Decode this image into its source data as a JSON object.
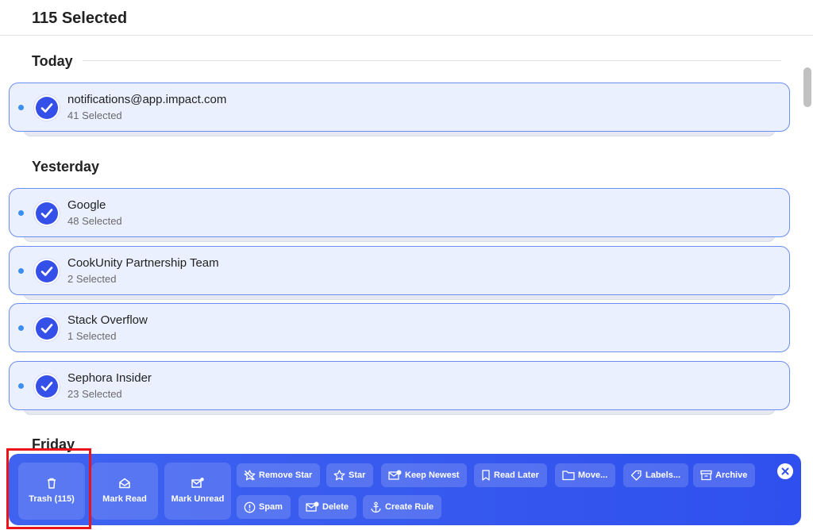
{
  "header": {
    "title": "115 Selected"
  },
  "sections": {
    "today": {
      "title": "Today",
      "groups": [
        {
          "name": "notifications@app.impact.com",
          "count": "41 Selected"
        }
      ]
    },
    "yesterday": {
      "title": "Yesterday",
      "groups": [
        {
          "name": "Google",
          "count": "48 Selected"
        },
        {
          "name": "CookUnity Partnership Team",
          "count": "2 Selected"
        },
        {
          "name": "Stack Overflow",
          "count": "1 Selected"
        },
        {
          "name": "Sephora Insider",
          "count": "23 Selected"
        }
      ]
    },
    "friday": {
      "title": "Friday"
    }
  },
  "toolbar": {
    "trash": "Trash (115)",
    "mark_read": "Mark Read",
    "mark_unread": "Mark Unread",
    "remove_star": "Remove Star",
    "star": "Star",
    "keep_newest": "Keep Newest",
    "read_later": "Read Later",
    "move": "Move...",
    "labels": "Labels...",
    "archive": "Archive",
    "spam": "Spam",
    "delete": "Delete",
    "create_rule": "Create Rule"
  },
  "colors": {
    "accent": "#3550e8",
    "toolbar_bg": "#3a5cf0",
    "card_bg": "#eaf0fe",
    "card_border": "#6b8cf0",
    "unread_dot": "#3a8ff0",
    "highlight": "#e8161b"
  },
  "icons": [
    "check-icon",
    "trash-icon",
    "envelope-open-icon",
    "envelope-dot-icon",
    "star-off-icon",
    "star-icon",
    "mail-badge-icon",
    "bookmark-icon",
    "folder-icon",
    "tag-icon",
    "archive-icon",
    "alert-circle-icon",
    "mail-delete-icon",
    "anchor-icon",
    "close-icon"
  ]
}
